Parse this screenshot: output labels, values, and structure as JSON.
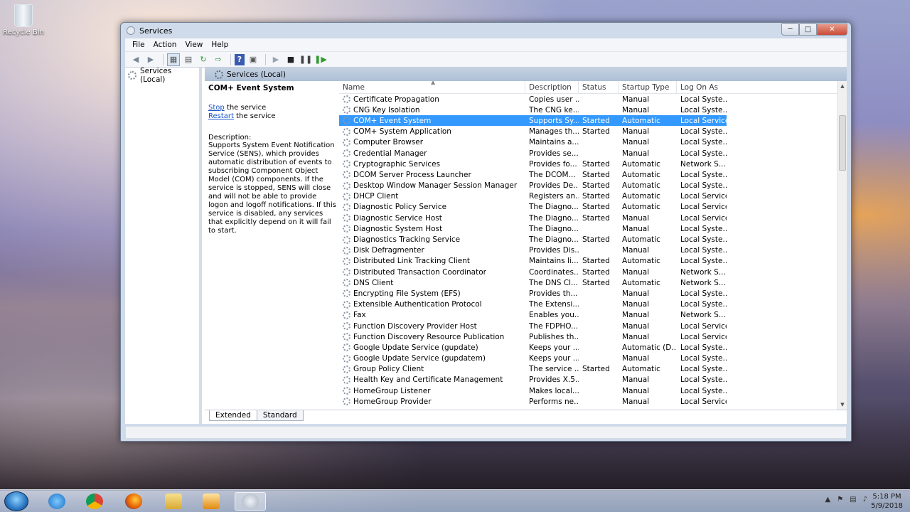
{
  "desktop": {
    "recycle_bin_label": "Recycle Bin"
  },
  "window": {
    "title": "Services",
    "menu": [
      "File",
      "Action",
      "View",
      "Help"
    ]
  },
  "tree": {
    "root_label": "Services (Local)"
  },
  "main": {
    "header": "Services (Local)",
    "selected_service": "COM+ Event System",
    "stop_link": "Stop",
    "stop_suffix": " the service",
    "restart_link": "Restart",
    "restart_suffix": " the service",
    "description_label": "Description:",
    "description_text": "Supports System Event Notification Service (SENS), which provides automatic distribution of events to subscribing Component Object Model (COM) components. If the service is stopped, SENS will close and will not be able to provide logon and logoff notifications. If this service is disabled, any services that explicitly depend on it will fail to start."
  },
  "columns": [
    "Name",
    "Description",
    "Status",
    "Startup Type",
    "Log On As"
  ],
  "rows": [
    {
      "name": "Certificate Propagation",
      "desc": "Copies user ...",
      "status": "",
      "startup": "Manual",
      "logon": "Local Syste..."
    },
    {
      "name": "CNG Key Isolation",
      "desc": "The CNG ke...",
      "status": "",
      "startup": "Manual",
      "logon": "Local Syste..."
    },
    {
      "name": "COM+ Event System",
      "desc": "Supports Sy...",
      "status": "Started",
      "startup": "Automatic",
      "logon": "Local Service",
      "selected": true
    },
    {
      "name": "COM+ System Application",
      "desc": "Manages th...",
      "status": "Started",
      "startup": "Manual",
      "logon": "Local Syste..."
    },
    {
      "name": "Computer Browser",
      "desc": "Maintains a...",
      "status": "",
      "startup": "Manual",
      "logon": "Local Syste..."
    },
    {
      "name": "Credential Manager",
      "desc": "Provides se...",
      "status": "",
      "startup": "Manual",
      "logon": "Local Syste..."
    },
    {
      "name": "Cryptographic Services",
      "desc": "Provides fo...",
      "status": "Started",
      "startup": "Automatic",
      "logon": "Network S..."
    },
    {
      "name": "DCOM Server Process Launcher",
      "desc": "The DCOM...",
      "status": "Started",
      "startup": "Automatic",
      "logon": "Local Syste..."
    },
    {
      "name": "Desktop Window Manager Session Manager",
      "desc": "Provides De...",
      "status": "Started",
      "startup": "Automatic",
      "logon": "Local Syste..."
    },
    {
      "name": "DHCP Client",
      "desc": "Registers an...",
      "status": "Started",
      "startup": "Automatic",
      "logon": "Local Service"
    },
    {
      "name": "Diagnostic Policy Service",
      "desc": "The Diagno...",
      "status": "Started",
      "startup": "Automatic",
      "logon": "Local Service"
    },
    {
      "name": "Diagnostic Service Host",
      "desc": "The Diagno...",
      "status": "Started",
      "startup": "Manual",
      "logon": "Local Service"
    },
    {
      "name": "Diagnostic System Host",
      "desc": "The Diagno...",
      "status": "",
      "startup": "Manual",
      "logon": "Local Syste..."
    },
    {
      "name": "Diagnostics Tracking Service",
      "desc": "The Diagno...",
      "status": "Started",
      "startup": "Automatic",
      "logon": "Local Syste..."
    },
    {
      "name": "Disk Defragmenter",
      "desc": "Provides Dis...",
      "status": "",
      "startup": "Manual",
      "logon": "Local Syste..."
    },
    {
      "name": "Distributed Link Tracking Client",
      "desc": "Maintains li...",
      "status": "Started",
      "startup": "Automatic",
      "logon": "Local Syste..."
    },
    {
      "name": "Distributed Transaction Coordinator",
      "desc": "Coordinates...",
      "status": "Started",
      "startup": "Manual",
      "logon": "Network S..."
    },
    {
      "name": "DNS Client",
      "desc": "The DNS Cl...",
      "status": "Started",
      "startup": "Automatic",
      "logon": "Network S..."
    },
    {
      "name": "Encrypting File System (EFS)",
      "desc": "Provides th...",
      "status": "",
      "startup": "Manual",
      "logon": "Local Syste..."
    },
    {
      "name": "Extensible Authentication Protocol",
      "desc": "The Extensi...",
      "status": "",
      "startup": "Manual",
      "logon": "Local Syste..."
    },
    {
      "name": "Fax",
      "desc": "Enables you...",
      "status": "",
      "startup": "Manual",
      "logon": "Network S..."
    },
    {
      "name": "Function Discovery Provider Host",
      "desc": "The FDPHO...",
      "status": "",
      "startup": "Manual",
      "logon": "Local Service"
    },
    {
      "name": "Function Discovery Resource Publication",
      "desc": "Publishes th...",
      "status": "",
      "startup": "Manual",
      "logon": "Local Service"
    },
    {
      "name": "Google Update Service (gupdate)",
      "desc": "Keeps your ...",
      "status": "",
      "startup": "Automatic (D...",
      "logon": "Local Syste..."
    },
    {
      "name": "Google Update Service (gupdatem)",
      "desc": "Keeps your ...",
      "status": "",
      "startup": "Manual",
      "logon": "Local Syste..."
    },
    {
      "name": "Group Policy Client",
      "desc": "The service ...",
      "status": "Started",
      "startup": "Automatic",
      "logon": "Local Syste..."
    },
    {
      "name": "Health Key and Certificate Management",
      "desc": "Provides X.5...",
      "status": "",
      "startup": "Manual",
      "logon": "Local Syste..."
    },
    {
      "name": "HomeGroup Listener",
      "desc": "Makes local...",
      "status": "",
      "startup": "Manual",
      "logon": "Local Syste..."
    },
    {
      "name": "HomeGroup Provider",
      "desc": "Performs ne...",
      "status": "",
      "startup": "Manual",
      "logon": "Local Service"
    }
  ],
  "tabs": [
    "Extended",
    "Standard"
  ],
  "taskbar": {
    "time": "5:18 PM",
    "date": "5/9/2018"
  },
  "colors": {
    "selection": "#3399ff",
    "link": "#1a55c9"
  }
}
